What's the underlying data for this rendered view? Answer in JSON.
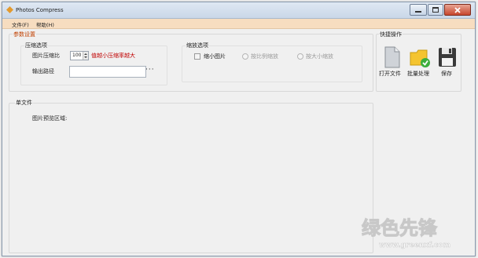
{
  "window": {
    "title": "Photos Compress"
  },
  "menu": [
    "文件(F)",
    "帮助(H)"
  ],
  "params": {
    "title": "参数设置",
    "compress": {
      "title": "压缩选项",
      "ratio_label": "图片压缩比",
      "ratio_value": "100",
      "hint": "值越小压缩率越大",
      "output_label": "输出路径",
      "output_value": "",
      "browse": "···"
    },
    "scale": {
      "title": "缩放选项",
      "shrink_label": "缩小图片",
      "proportional_label": "按比例缩放",
      "fixed_label": "按大小缩放"
    }
  },
  "quick": {
    "title": "快捷操作",
    "open": "打开文件",
    "batch": "批量处理",
    "save": "保存"
  },
  "single": {
    "title": "单文件",
    "preview": "图片预览区域:"
  },
  "watermark": {
    "line1": "绿色先锋",
    "line2": "www.greenxf.com"
  },
  "colors": {
    "menubar": "#f7ddc0",
    "hint": "#c00000",
    "group_title": "#c04000"
  }
}
